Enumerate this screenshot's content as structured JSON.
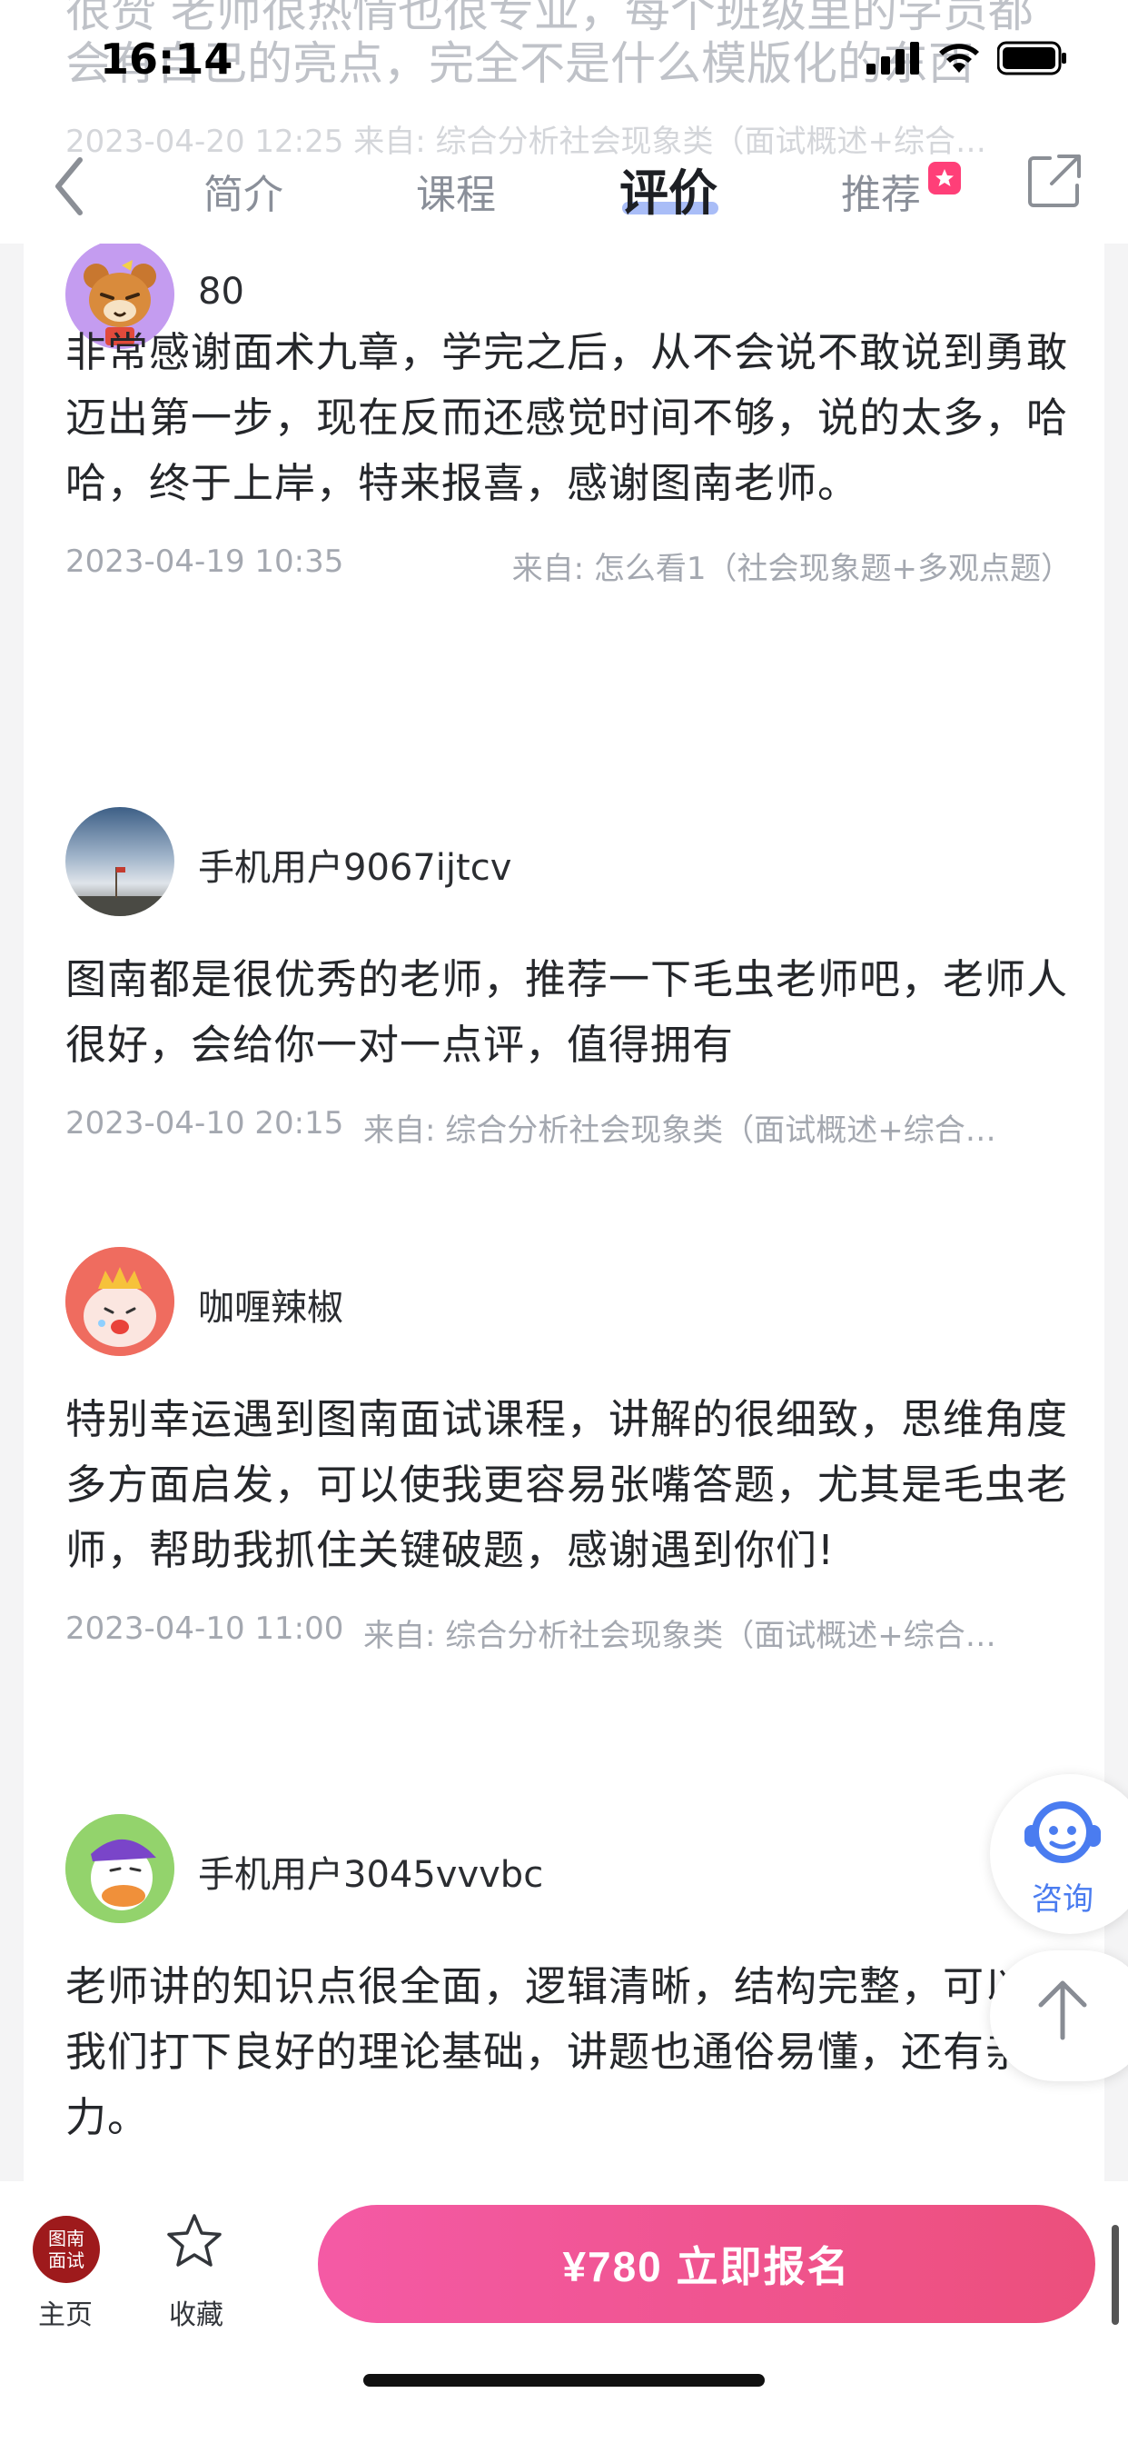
{
  "status_bar": {
    "time": "16:14"
  },
  "ghost_behind_header": {
    "line1": "很赞 老师很热情也很专业，每个班级里的学员都",
    "line2": "会有自己的亮点，完全不是什么模版化的东西",
    "line3": "2023-04-20 12:25  来自: 综合分析社会现象类（面试概述+综合…"
  },
  "nav": {
    "tabs": [
      {
        "label": "简介"
      },
      {
        "label": "课程"
      },
      {
        "label": "评价"
      },
      {
        "label": "推荐"
      }
    ],
    "active_tab": "评价"
  },
  "reviews": [
    {
      "username": "80",
      "text": "非常感谢面术九章，学完之后，从不会说不敢说到勇敢迈出第一步，现在反而还感觉时间不够，说的太多，哈哈，终于上岸，特来报喜，感谢图南老师。",
      "date": "2023-04-19 10:35",
      "source": "来自: 怎么看1（社会现象题+多观点题）"
    },
    {
      "username": "手机用户9067ijtcv",
      "text": "图南都是很优秀的老师，推荐一下毛虫老师吧，老师人很好，会给你一对一点评，值得拥有",
      "date": "2023-04-10 20:15",
      "source": "来自: 综合分析社会现象类（面试概述+综合…"
    },
    {
      "username": "咖喱辣椒",
      "text": "特别幸运遇到图南面试课程，讲解的很细致，思维角度多方面启发，可以使我更容易张嘴答题，尤其是毛虫老师，帮助我抓住关键破题，感谢遇到你们!",
      "date": "2023-04-10 11:00",
      "source": "来自: 综合分析社会现象类（面试概述+综合…"
    },
    {
      "username": "手机用户3045vvvbc",
      "text": "老师讲的知识点很全面，逻辑清晰，结构完整，可以给我们打下良好的理论基础，讲题也通俗易懂，还有亲和力。"
    }
  ],
  "floating": {
    "consult_label": "咨询"
  },
  "bottom_bar": {
    "home_logo_text": "图南面试",
    "home_label": "主页",
    "favorite_label": "收藏",
    "cta_label": "¥780  立即报名"
  },
  "colors": {
    "cta_gradient_start": "#f45aa5",
    "cta_gradient_end": "#ec4f7c",
    "accent_blue": "#4a7cf0",
    "badge_pink": "#ff3f78",
    "logo_red": "#9e1a1c"
  }
}
